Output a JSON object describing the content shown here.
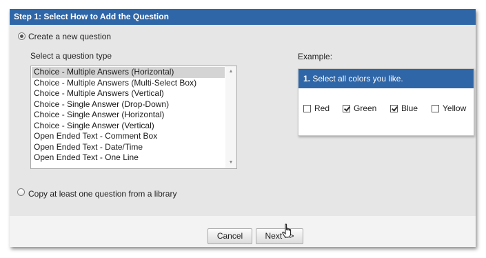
{
  "header": {
    "title": "Step 1: Select How to Add the Question"
  },
  "create_option": {
    "label": "Create a new question",
    "checked": true
  },
  "question_type": {
    "label": "Select a question type",
    "items": [
      "Choice - Multiple Answers (Horizontal)",
      "Choice - Multiple Answers (Multi-Select Box)",
      "Choice - Multiple Answers (Vertical)",
      "Choice - Single Answer (Drop-Down)",
      "Choice - Single Answer (Horizontal)",
      "Choice - Single Answer (Vertical)",
      "Open Ended Text - Comment Box",
      "Open Ended Text - Date/Time",
      "Open Ended Text - One Line"
    ],
    "selected_index": 0
  },
  "example": {
    "label": "Example:",
    "number": "1.",
    "question": "Select all colors you like.",
    "options": [
      {
        "label": "Red",
        "checked": false
      },
      {
        "label": "Green",
        "checked": true
      },
      {
        "label": "Blue",
        "checked": true
      },
      {
        "label": "Yellow",
        "checked": false
      }
    ]
  },
  "copy_option": {
    "label": "Copy at least one question from a library",
    "checked": false
  },
  "buttons": {
    "cancel": "Cancel",
    "next": "Next >>"
  },
  "icons": {
    "scroll_up": "scroll-up-arrow-icon",
    "scroll_down": "scroll-down-arrow-icon",
    "cursor": "hand-pointer-icon"
  },
  "colors": {
    "header": "#2f66a8",
    "panel": "#e6e6e6",
    "selection": "#d4d4d4"
  }
}
